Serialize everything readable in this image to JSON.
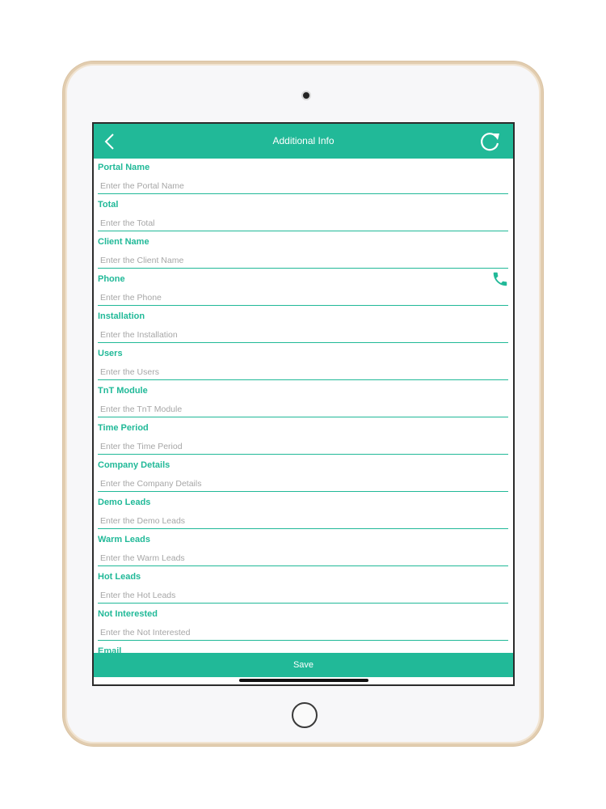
{
  "nav": {
    "title": "Additional Info"
  },
  "fields": [
    {
      "label": "Portal Name",
      "placeholder": "Enter the Portal Name"
    },
    {
      "label": "Total",
      "placeholder": "Enter the Total"
    },
    {
      "label": "Client Name",
      "placeholder": "Enter the Client Name"
    },
    {
      "label": "Phone",
      "placeholder": "Enter the Phone"
    },
    {
      "label": "Installation",
      "placeholder": "Enter the Installation"
    },
    {
      "label": "Users",
      "placeholder": "Enter the Users"
    },
    {
      "label": "TnT Module",
      "placeholder": "Enter the TnT Module"
    },
    {
      "label": "Time Period",
      "placeholder": "Enter the Time Period"
    },
    {
      "label": "Company Details",
      "placeholder": "Enter the Company Details"
    },
    {
      "label": "Demo Leads",
      "placeholder": "Enter the Demo Leads"
    },
    {
      "label": "Warm Leads",
      "placeholder": "Enter the Warm Leads"
    },
    {
      "label": "Hot Leads",
      "placeholder": "Enter the Hot Leads"
    },
    {
      "label": "Not Interested",
      "placeholder": "Enter the Not Interested"
    },
    {
      "label": "Email",
      "placeholder": ""
    }
  ],
  "save_label": "Save",
  "icons": {
    "back": "chevron-left-icon",
    "refresh": "refresh-icon",
    "phone": "phone-icon"
  },
  "colors": {
    "accent": "#21b998"
  }
}
